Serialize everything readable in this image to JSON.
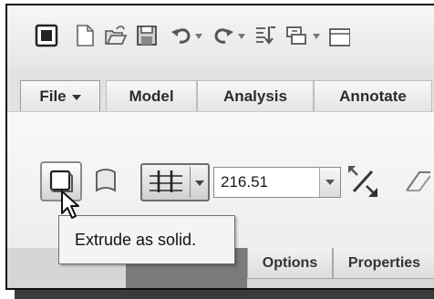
{
  "quick_access": {
    "icons": [
      "window-icon",
      "new-icon",
      "open-icon",
      "save-icon",
      "undo-icon",
      "redo-icon",
      "regenerate-icon",
      "windows-icon",
      "close-icon"
    ]
  },
  "ribbon_tabs": {
    "file": "File",
    "model": "Model",
    "analysis": "Analysis",
    "annotate": "Annotate"
  },
  "extrude_dashboard": {
    "depth_value": "216.51",
    "tooltip": "Extrude as solid."
  },
  "dashboard_tabs": {
    "options": "Options",
    "properties": "Properties"
  }
}
